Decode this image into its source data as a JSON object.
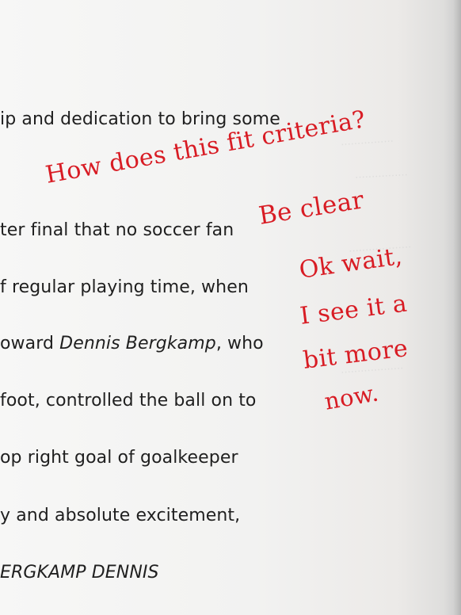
{
  "document": {
    "lines": [
      "ip and dedication to bring some",
      "ter final that no soccer fan",
      "f regular playing time, when",
      "oward Dennis Bergkamp, who",
      "foot, controlled the ball on to",
      "op right goal of goalkeeper",
      "y and absolute excitement,",
      "ERGKAMP DENNIS"
    ],
    "line4": {
      "prefix": "oward ",
      "italic": "Dennis Bergkamp",
      "suffix": ", who"
    },
    "footer": "ERGKAMP DENNIS"
  },
  "handwriting": {
    "comment_1": "How does this fit criteria?",
    "comment_2": "Be clear",
    "comment_3_line_1": "Ok wait,",
    "comment_3_line_2": "I see it a",
    "comment_3_line_3": "bit more",
    "comment_3_line_4": "now."
  }
}
